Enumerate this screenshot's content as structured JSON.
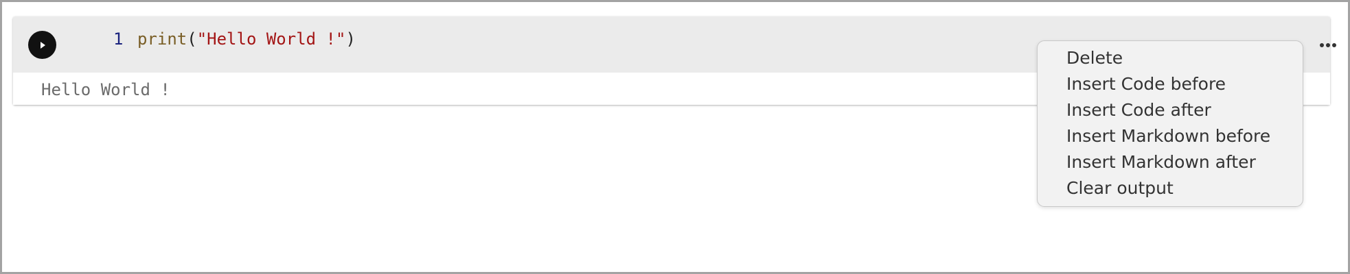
{
  "cell": {
    "line_number": "1",
    "code_tokens": {
      "func": "print",
      "open_paren": "(",
      "string": "\"Hello World !\"",
      "close_paren": ")"
    },
    "output": "Hello World !",
    "run_icon": "play-icon",
    "more_icon": "more-horizontal-icon"
  },
  "context_menu": {
    "items": [
      "Delete",
      "Insert Code before",
      "Insert Code after",
      "Insert Markdown before",
      "Insert Markdown after",
      "Clear output"
    ]
  },
  "colors": {
    "cell_input_bg": "#ebebeb",
    "func": "#795e26",
    "string": "#a31515",
    "line_number": "#1a237e",
    "output_text": "#6b6b6b",
    "menu_bg": "#f2f2f2"
  }
}
